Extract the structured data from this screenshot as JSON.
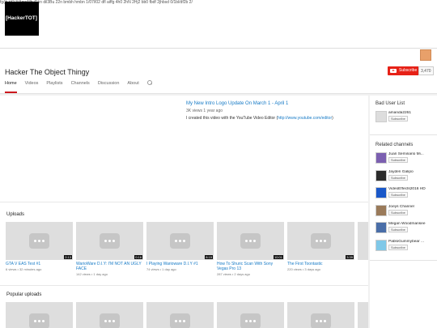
{
  "banner": {
    "logo_text": "[HackerTOT]",
    "strip_text": "fg/jh t/t2 3/AmnMb /Ekn dil3Bu 22n bmbh hmbn 1/07/l02 dfl aiffg 4h0 2hN 2Hj2 bb0 fbdf 2jhbsd 0/1bl/df2b 2/"
  },
  "channel": {
    "title": "Hacker The Object Thingy",
    "subscribe_label": "Subscribe",
    "subscriber_count": "3,470"
  },
  "tabs": [
    "Home",
    "Videos",
    "Playlists",
    "Channels",
    "Discussion",
    "About"
  ],
  "featured": {
    "title": "My New Intro Logo Update On March 1 - April 1",
    "meta": "3K views  1 year ago",
    "desc_prefix": "I created this video with the YouTube Video Editor (",
    "desc_link": "http://www.youtube.com/editor",
    "desc_suffix": ")"
  },
  "uploads": {
    "title": "Uploads",
    "videos": [
      {
        "title": "GTA V EAS Test #1",
        "meta": "6 views • 32 minutes ago",
        "duration": "2:13"
      },
      {
        "title": "WarioWare D.I.Y: I'M NOT AN UGLY FACE",
        "meta": "142 views • 1 day ago",
        "duration": "0:16"
      },
      {
        "title": "I Playing Warioware D.I.Y #1",
        "meta": "74 views • 1 day ago",
        "duration": "8:15"
      },
      {
        "title": "How To Shuric Scan With Sony Vegas Pro 13",
        "meta": "287 views • 2 days ago",
        "duration": "10:01"
      },
      {
        "title": "The First Toontastic",
        "meta": "220 views • 3 days ago",
        "duration": "3:39"
      }
    ]
  },
  "popular": {
    "title": "Popular uploads"
  },
  "sidebar": {
    "bad_user_list": {
      "title": "Bad User List",
      "user": "amanda2261",
      "subscribe_label": "Subscribe"
    },
    "related": {
      "title": "Related channels",
      "subscribe_label": "Subscribe",
      "channels": [
        {
          "name": "Juan Seminario Mi...",
          "color": "#7b5fb0"
        },
        {
          "name": "Jayden Galipo",
          "color": "#2b2b2b"
        },
        {
          "name": "VideoEffects2016 HD",
          "color": "#1a58c9"
        },
        {
          "name": "Joeys Channel",
          "color": "#9a7a5a"
        },
        {
          "name": "Megan Woodmansee",
          "color": "#4a6ea8"
        },
        {
          "name": "PabloGummybear ...",
          "color": "#7fc8e8"
        }
      ]
    }
  }
}
